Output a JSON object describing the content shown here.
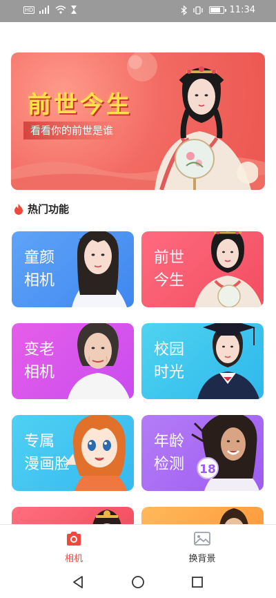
{
  "status_bar": {
    "network_label": "HD",
    "time": "11:34",
    "battery_level": 0.7
  },
  "hero": {
    "title": "前世今生",
    "subtitle": "看看你的前世是谁"
  },
  "section": {
    "title": "热门功能",
    "icon": "flame-icon"
  },
  "cards": [
    {
      "line1": "童颜",
      "line2": "相机"
    },
    {
      "line1": "前世",
      "line2": "今生"
    },
    {
      "line1": "变老",
      "line2": "相机"
    },
    {
      "line1": "校园",
      "line2": "时光"
    },
    {
      "line1": "专属",
      "line2": "漫画脸"
    },
    {
      "line1": "年龄",
      "line2": "检测",
      "badge": "18"
    }
  ],
  "bottom_nav": {
    "camera_label": "相机",
    "background_label": "换背景",
    "active": "camera",
    "accent_color": "#f0483f"
  },
  "system_nav": [
    "back-icon",
    "home-icon",
    "recents-icon"
  ]
}
